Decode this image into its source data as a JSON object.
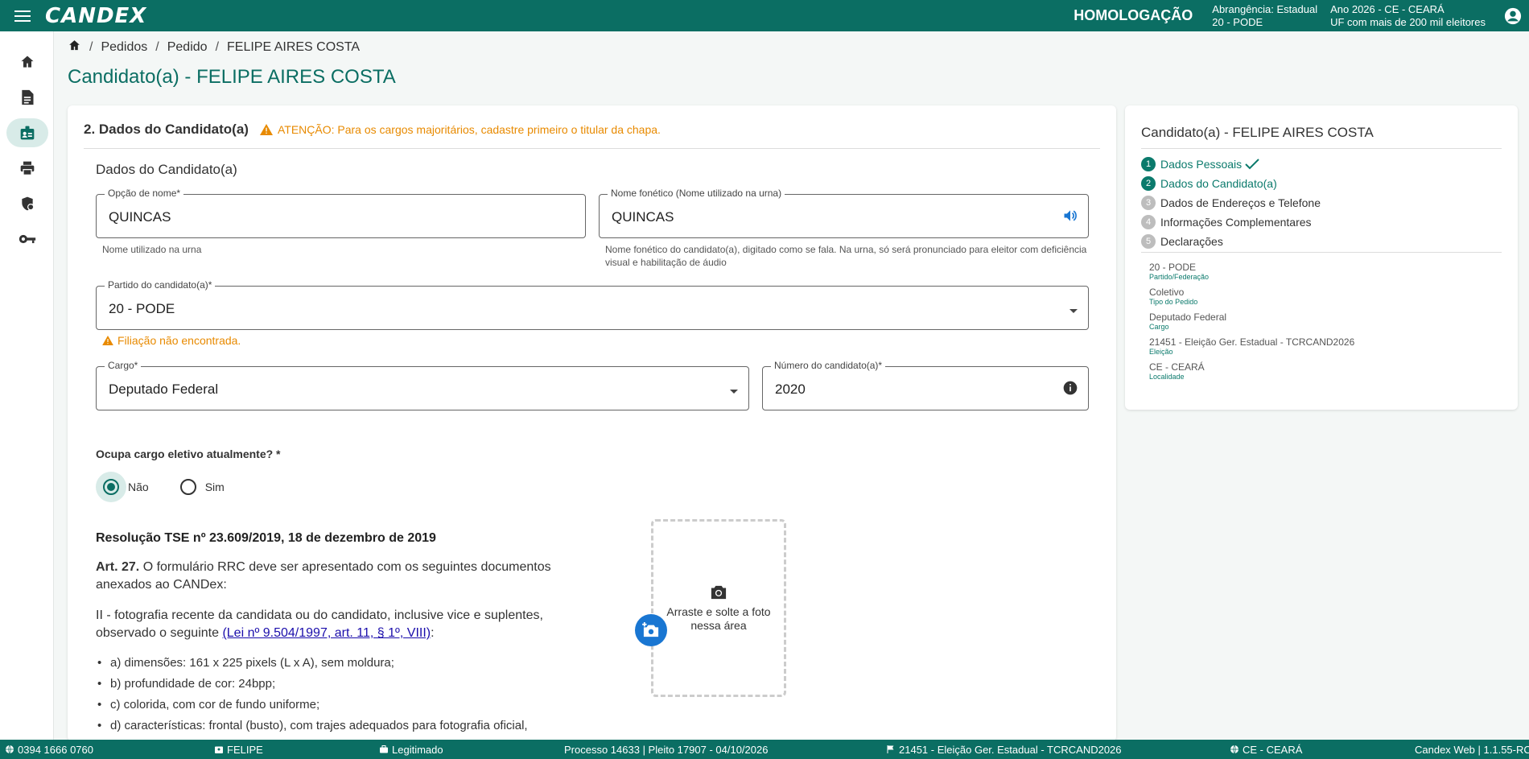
{
  "app": {
    "logo": "CANDEX",
    "environment": "HOMOLOGAÇÃO",
    "scope_line1": "Abrangência: Estadual",
    "scope_line2": "20 - PODE",
    "year_line1": "Ano 2026 - CE - CEARÁ",
    "year_line2": "UF com mais de 200 mil eleitores"
  },
  "sidebar": {
    "items": [
      {
        "icon": "home-icon"
      },
      {
        "icon": "document-icon"
      },
      {
        "icon": "candidate-badge-icon",
        "active": true
      },
      {
        "icon": "printer-icon"
      },
      {
        "icon": "shield-user-icon"
      },
      {
        "icon": "key-icon"
      }
    ]
  },
  "breadcrumb": {
    "items": [
      "Pedidos",
      "Pedido",
      "FELIPE AIRES COSTA"
    ]
  },
  "page": {
    "title": "Candidato(a) - FELIPE AIRES COSTA"
  },
  "form": {
    "section_title": "2. Dados do Candidato(a)",
    "section_warning": "ATENÇÃO: Para os cargos majoritários, cadastre primeiro o titular da chapa.",
    "subtitle": "Dados do Candidato(a)",
    "name_option": {
      "label": "Opção de nome*",
      "value": "QUINCAS",
      "hint": "Nome utilizado na urna"
    },
    "phonetic_name": {
      "label": "Nome fonético (Nome utilizado na urna)",
      "value": "QUINCAS",
      "hint": "Nome fonético do candidato(a), digitado como se fala. Na urna, só será pronunciado para eleitor com deficiência visual e habilitação de áudio"
    },
    "party": {
      "label": "Partido do candidato(a)*",
      "value": "20 - PODE",
      "warning": "Filiação não encontrada."
    },
    "position": {
      "label": "Cargo*",
      "value": "Deputado Federal"
    },
    "candidate_number": {
      "label": "Número do candidato(a)*",
      "value": "2020"
    },
    "elective_question": "Ocupa cargo eletivo atualmente? *",
    "radio_no": "Não",
    "radio_yes": "Sim",
    "resolution_title": "Resolução TSE nº 23.609/2019, 18 de dezembro de 2019",
    "art_bold": "Art. 27.",
    "art_text": " O formulário RRC deve ser apresentado com os seguintes documentos anexados ao CANDex:",
    "item_ii_text": "II - fotografia recente da candidata ou do candidato, inclusive vice e suplentes, observado o seguinte ",
    "item_ii_link": "(Lei nº 9.504/1997, art. 11, § 1º, VIII)",
    "item_ii_end": ":",
    "list": [
      "a) dimensões: 161 x 225 pixels (L x A), sem moldura;",
      "b) profundidade de cor: 24bpp;",
      "c) colorida, com cor de fundo uniforme;",
      "d) características: frontal (busto), com trajes adequados para fotografia oficial,"
    ],
    "dropzone_text": "Arraste e solte a foto nessa área"
  },
  "side_card": {
    "title": "Candidato(a) - FELIPE AIRES COSTA",
    "steps": [
      {
        "num": "1",
        "label": "Dados Pessoais",
        "state": "done"
      },
      {
        "num": "2",
        "label": "Dados do Candidato(a)",
        "state": "active"
      },
      {
        "num": "3",
        "label": "Dados de Endereços e Telefone",
        "state": "pending"
      },
      {
        "num": "4",
        "label": "Informações Complementares",
        "state": "pending"
      },
      {
        "num": "5",
        "label": "Declarações",
        "state": "pending"
      }
    ],
    "summary": [
      {
        "value": "20 - PODE",
        "label": "Partido/Federação"
      },
      {
        "value": "Coletivo",
        "label": "Tipo do Pedido"
      },
      {
        "value": "Deputado Federal",
        "label": "Cargo"
      },
      {
        "value": "21451 - Eleição Ger. Estadual - TCRCAND2026",
        "label": "Eleição"
      },
      {
        "value": "CE - CEARÁ",
        "label": "Localidade"
      }
    ]
  },
  "statusbar": {
    "phone": "0394 1666 0760",
    "user": "FELIPE",
    "role": "Legitimado",
    "process": "Processo 14633 | Pleito 17907 - 04/10/2026",
    "election": "21451 - Eleição Ger. Estadual - TCRCAND2026",
    "locality": "CE - CEARÁ",
    "version": "Candex Web | 1.1.55-RC"
  },
  "colors": {
    "primary": "#0b6e63",
    "warning": "#e88a00",
    "link": "#1a0dab"
  }
}
